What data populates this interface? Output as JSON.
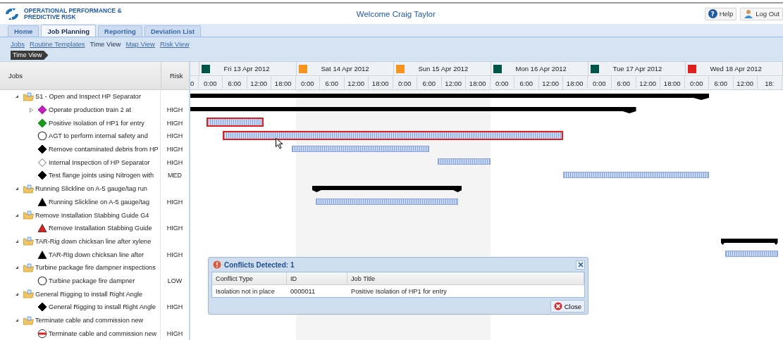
{
  "app": {
    "title_lines": [
      "OPERATIONAL PERFORMANCE &",
      "PREDICTIVE RISK"
    ],
    "welcome": "Welcome Craig Taylor",
    "buttons": [
      {
        "label": "Help",
        "kind": "help",
        "icon": "?"
      },
      {
        "label": "Log Out",
        "kind": "logout"
      }
    ]
  },
  "tabs": [
    {
      "label": "Home",
      "selected": false
    },
    {
      "label": "Job Planning",
      "selected": true
    },
    {
      "label": "Reporting",
      "selected": false
    },
    {
      "label": "Deviation List",
      "selected": false
    }
  ],
  "subnav": [
    {
      "label": "Jobs",
      "selected": false
    },
    {
      "label": "Routine Templates",
      "selected": false
    },
    {
      "label": "Time View",
      "selected": true
    },
    {
      "label": "Map View",
      "selected": false
    },
    {
      "label": "Risk View",
      "selected": false
    }
  ],
  "breadcrumb": "Time View",
  "grid": {
    "columns": [
      "Jobs",
      "Risk"
    ],
    "timeline": {
      "leading_label": "0",
      "days": [
        {
          "label": "Fri 13 Apr 2012",
          "color": "#005548",
          "weekend": false,
          "hours": [
            "0:00",
            "6:00",
            "12:00",
            "18:00"
          ]
        },
        {
          "label": "Sat 14 Apr 2012",
          "color": "#f7941d",
          "weekend": true,
          "hours": [
            "0:00",
            "6:00",
            "12:00",
            "18:00"
          ]
        },
        {
          "label": "Sun 15 Apr 2012",
          "color": "#f7941d",
          "weekend": true,
          "hours": [
            "0:00",
            "6:00",
            "12:00",
            "18:00"
          ]
        },
        {
          "label": "Mon 16 Apr 2012",
          "color": "#005548",
          "weekend": false,
          "hours": [
            "0:00",
            "6:00",
            "12:00",
            "18:00"
          ]
        },
        {
          "label": "Tue 17 Apr 2012",
          "color": "#005548",
          "weekend": false,
          "hours": [
            "0:00",
            "6:00",
            "12:00",
            "18:00"
          ]
        },
        {
          "label": "Wed 18 Apr 2012",
          "color": "#e0201f",
          "weekend": false,
          "hours": [
            "0:00",
            "6:00",
            "12:00",
            "18:"
          ]
        }
      ]
    },
    "jobs": [
      {
        "title": "S1 - Open and Inspect HP Separator",
        "expanded": true,
        "bar": {
          "kind": "summary"
        },
        "children": [
          {
            "title": "Operate production train 2 at",
            "risk": "HIGH",
            "kind": "diamond",
            "color": "#c020c0",
            "collapsed_children": true,
            "bar": {
              "kind": "summary"
            }
          },
          {
            "title": "Positive Isolation of HP1 for entry",
            "risk": "HIGH",
            "kind": "diamond",
            "color": "#1a9a1a",
            "collapsed_children": false,
            "bar": {
              "kind": "task",
              "conflict": true
            }
          },
          {
            "title": "AGT to perform internal safety and",
            "risk": "HIGH",
            "kind": "circle",
            "collapsed_children": false,
            "bar": {
              "kind": "task",
              "conflict": true
            }
          },
          {
            "title": "Remove contaminated debris from HP",
            "risk": "HIGH",
            "kind": "diamond",
            "color": "#000000",
            "collapsed_children": false,
            "bar": {
              "kind": "task",
              "conflict": false
            }
          },
          {
            "title": "Internal Inspection of HP Separator",
            "risk": "HIGH",
            "kind": "diamond-outline",
            "collapsed_children": false,
            "bar": {
              "kind": "task",
              "conflict": false
            }
          },
          {
            "title": "Test flange joints using Nitrogen with",
            "risk": "MED",
            "kind": "diamond",
            "color": "#000000",
            "collapsed_children": false,
            "bar": {
              "kind": "task",
              "conflict": false
            }
          }
        ]
      },
      {
        "title": "Running Slickline on A-5 gauge/tag run",
        "expanded": true,
        "bar": {
          "kind": "summary"
        },
        "children": [
          {
            "title": "Running Slickline on A-5 gauge/tag",
            "risk": "HIGH",
            "kind": "triangle",
            "color": "#000000",
            "collapsed_children": false,
            "bar": {
              "kind": "task",
              "conflict": false
            }
          }
        ]
      },
      {
        "title": "Remove Installation Stabbing Guide G4",
        "expanded": true,
        "children": [
          {
            "title": "Remove Installation Stabbing Guide",
            "risk": "HIGH",
            "kind": "triangle",
            "color": "#e0201f",
            "collapsed_children": false
          }
        ]
      },
      {
        "title": "TAR-Rig down chicksan line after xylene",
        "expanded": true,
        "bar": {
          "kind": "summary"
        },
        "children": [
          {
            "title": "TAR-Rig down chicksan line after",
            "risk": "HIGH",
            "kind": "triangle",
            "color": "#000000",
            "collapsed_children": false,
            "bar": {
              "kind": "task",
              "conflict": false
            }
          }
        ]
      },
      {
        "title": "Turbine package fire dampner inspections",
        "expanded": true,
        "children": [
          {
            "title": "Turbine package fire dampner",
            "risk": "LOW",
            "kind": "circle",
            "collapsed_children": false
          }
        ]
      },
      {
        "title": "General Rigging to install Right Angle",
        "expanded": true,
        "children": [
          {
            "title": "General Rigging to install Right Angle",
            "risk": "HIGH",
            "kind": "diamond",
            "color": "#000000",
            "collapsed_children": false
          }
        ]
      },
      {
        "title": "Terminate cable and commission new",
        "expanded": true,
        "children": [
          {
            "title": "Terminate cable and commission new",
            "risk": "HIGH",
            "kind": "barred-circle",
            "color": "#e0201f",
            "collapsed_children": false
          }
        ]
      }
    ]
  },
  "dialog": {
    "title": "Conflicts Detected: 1",
    "columns": [
      "Conflict Type",
      "ID",
      "Job Title"
    ],
    "rows": [
      [
        "Isolation not in place",
        "0000011",
        "Positive Isolation of HP1 for entry"
      ]
    ],
    "button": "Close"
  }
}
